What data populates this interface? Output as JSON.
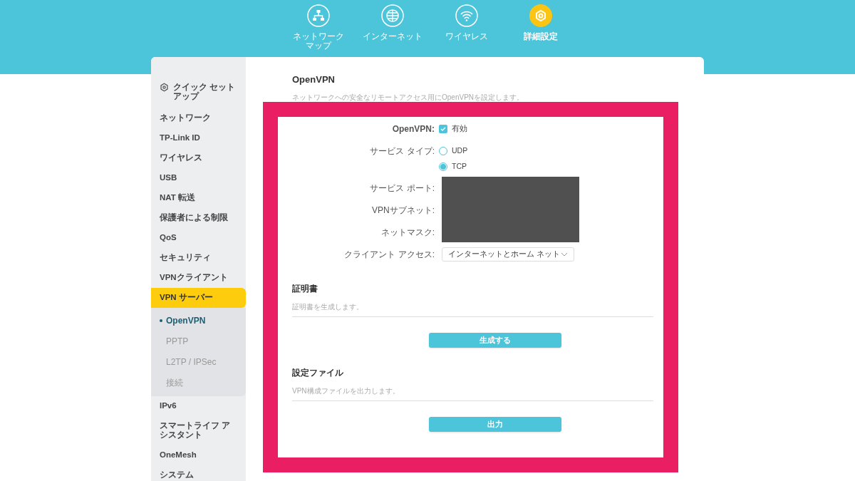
{
  "top_nav": [
    {
      "label": "ネットワークマップ",
      "selected": false
    },
    {
      "label": "インターネット",
      "selected": false
    },
    {
      "label": "ワイヤレス",
      "selected": false
    },
    {
      "label": "詳細設定",
      "selected": true
    }
  ],
  "sidebar": {
    "items": [
      {
        "label": "クイック セットアップ",
        "selected": false
      },
      {
        "label": "ネットワーク",
        "selected": false
      },
      {
        "label": "TP-Link ID",
        "selected": false
      },
      {
        "label": "ワイヤレス",
        "selected": false
      },
      {
        "label": "USB",
        "selected": false
      },
      {
        "label": "NAT 転送",
        "selected": false
      },
      {
        "label": "保護者による制限",
        "selected": false
      },
      {
        "label": "QoS",
        "selected": false
      },
      {
        "label": "セキュリティ",
        "selected": false
      },
      {
        "label": "VPNクライアント",
        "selected": false
      },
      {
        "label": "VPN サーバー",
        "selected": true,
        "expanded": true,
        "children": [
          {
            "label": "OpenVPN",
            "selected": true
          },
          {
            "label": "PPTP",
            "selected": false
          },
          {
            "label": "L2TP / IPSec",
            "selected": false
          },
          {
            "label": "接続",
            "selected": false
          }
        ]
      },
      {
        "label": "IPv6",
        "selected": false
      },
      {
        "label": "スマートライフ アシスタント",
        "selected": false
      },
      {
        "label": "OneMesh",
        "selected": false
      },
      {
        "label": "システム",
        "selected": false
      }
    ]
  },
  "content": {
    "title": "OpenVPN",
    "description": "ネットワークへの安全なリモートアクセス用にOpenVPNを設定します。",
    "openvpn": {
      "label": "OpenVPN:",
      "checkbox_label": "有効",
      "checked": true
    },
    "service_type": {
      "label": "サービス タイプ:",
      "options": [
        {
          "label": "UDP",
          "selected": false
        },
        {
          "label": "TCP",
          "selected": true
        }
      ]
    },
    "hidden_fields": [
      {
        "label": "サービス ポート:"
      },
      {
        "label": "VPNサブネット:"
      },
      {
        "label": "ネットマスク:"
      }
    ],
    "client_access": {
      "label": "クライアント アクセス:",
      "value": "インターネットとホーム ネット"
    },
    "sections": [
      {
        "title": "証明書",
        "description": "証明書を生成します。",
        "button": "生成する"
      },
      {
        "title": "設定ファイル",
        "description": "VPN構成ファイルを出力します。",
        "button": "出力"
      }
    ]
  }
}
